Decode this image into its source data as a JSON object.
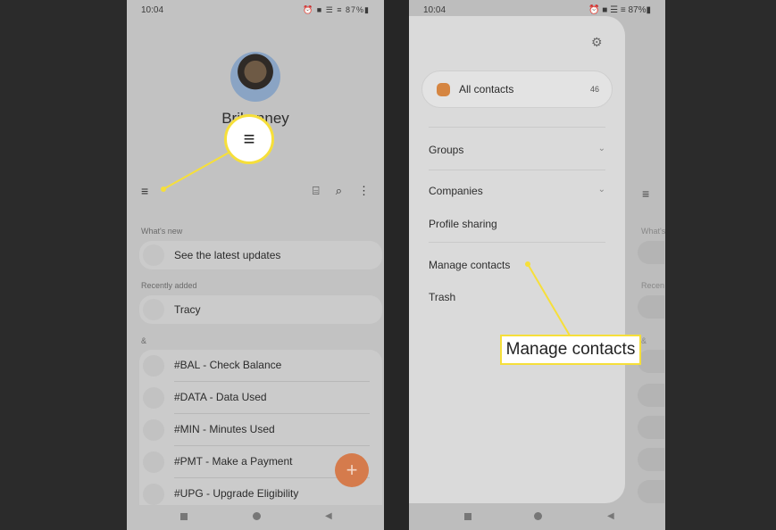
{
  "left_screen": {
    "status_time": "10:04",
    "status_icons": "⏰ ■ ☰ ≡ 87%▮",
    "profile_name": "Bril       enney",
    "menu_icon": "hamburger-menu-icon",
    "callout_glyph": "≡",
    "toolbar_icons": [
      "qr-scan-icon",
      "search-icon",
      "more-vert-icon"
    ],
    "toolbar_glyphs": [
      "⌸",
      "⌕",
      "⋮"
    ],
    "sections": {
      "whats_new": "What's new",
      "recently_added": "Recently added",
      "ampersand": "&"
    },
    "whats_new_item": "See the latest updates",
    "recent_item": "Tracy",
    "contacts": [
      "#BAL - Check Balance",
      "#DATA - Data Used",
      "#MIN - Minutes Used",
      "#PMT - Make a Payment",
      "#UPG - Upgrade Eligibility"
    ],
    "fab_glyph": "+"
  },
  "right_screen": {
    "status_time": "10:04",
    "status_icons": "⏰ ■ ☰ ≡ 87%▮",
    "settings_icon": "gear-icon",
    "all_contacts_label": "All contacts",
    "all_contacts_count": "46",
    "groups_label": "Groups",
    "companies_label": "Companies",
    "profile_sharing_label": "Profile sharing",
    "manage_contacts_label": "Manage contacts",
    "trash_label": "Trash",
    "bg_whats_stub": "What's",
    "bg_recent_stub": "Recen",
    "bg_amp_stub": "&"
  },
  "callout": {
    "label": "Manage contacts",
    "accent_color": "#f6df3a"
  },
  "colors": {
    "fab": "#d57b4c",
    "contact_badge": "#d58541"
  }
}
